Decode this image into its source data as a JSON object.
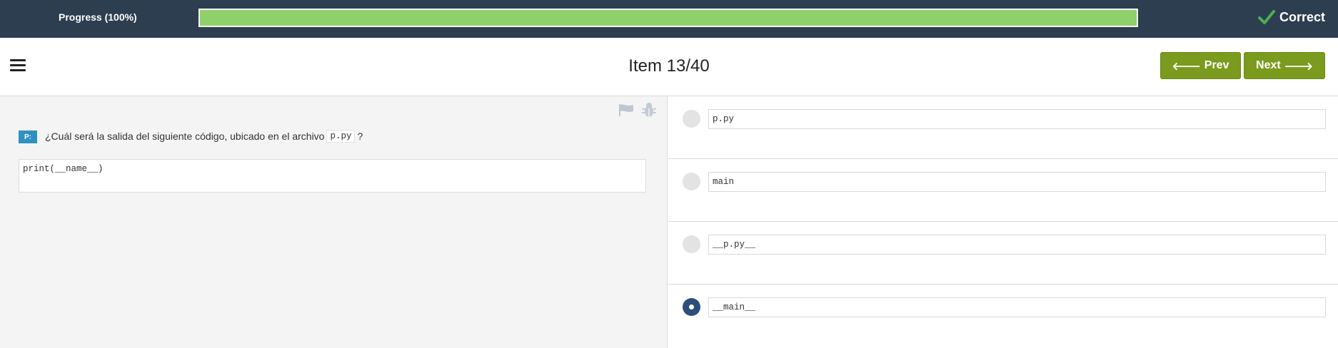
{
  "progress": {
    "label": "Progress (100%)",
    "percent": 100,
    "fill_color": "#8fd06a"
  },
  "status": {
    "icon": "check-icon",
    "label": "Correct"
  },
  "header": {
    "menu_icon": "hamburger-menu-icon",
    "title": "Item 13/40",
    "prev_label": "Prev",
    "next_label": "Next",
    "button_color": "#7a9b1e"
  },
  "question": {
    "badge": "P:",
    "text": "¿Cuál será la salida del siguiente código, ubicado en el archivo",
    "filename": "p.py",
    "suffix": "?",
    "code": "print(__name__)",
    "toolbar_icons": [
      "flag-icon",
      "bug-icon"
    ]
  },
  "options": [
    {
      "text": "p.py",
      "selected": false
    },
    {
      "text": "main",
      "selected": false
    },
    {
      "text": "__p.py__",
      "selected": false
    },
    {
      "text": "__main__",
      "selected": true
    }
  ],
  "colors": {
    "topbar": "#2d3e50",
    "badge": "#2e91c0",
    "radio_selected": "#2d4d7c"
  }
}
